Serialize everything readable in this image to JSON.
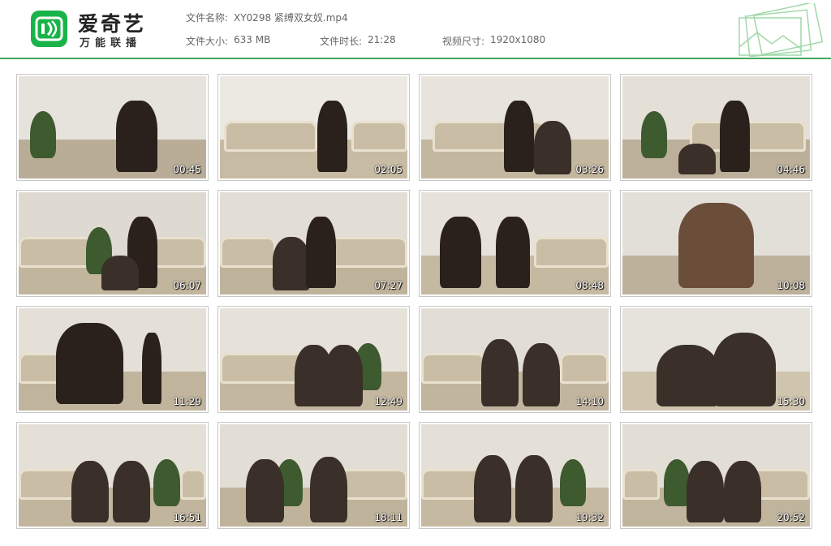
{
  "brand": {
    "name": "爱奇艺",
    "subtitle": "万能联播",
    "color": "#19b34a"
  },
  "file": {
    "name_label": "文件名称:",
    "name_value": "XY0298 紧缚双女奴.mp4",
    "size_label": "文件大小:",
    "size_value": "633 MB",
    "duration_label": "文件时长:",
    "duration_value": "21:28",
    "resolution_label": "视频尺寸:",
    "resolution_value": "1920x1080"
  },
  "thumbnails": [
    {
      "time": "00:45"
    },
    {
      "time": "02:05"
    },
    {
      "time": "03:26"
    },
    {
      "time": "04:46"
    },
    {
      "time": "06:07"
    },
    {
      "time": "07:27"
    },
    {
      "time": "08:48"
    },
    {
      "time": "10:08"
    },
    {
      "time": "11:29"
    },
    {
      "time": "12:49"
    },
    {
      "time": "14:10"
    },
    {
      "time": "15:30"
    },
    {
      "time": "16:51"
    },
    {
      "time": "18:11"
    },
    {
      "time": "19:32"
    },
    {
      "time": "20:52"
    }
  ]
}
